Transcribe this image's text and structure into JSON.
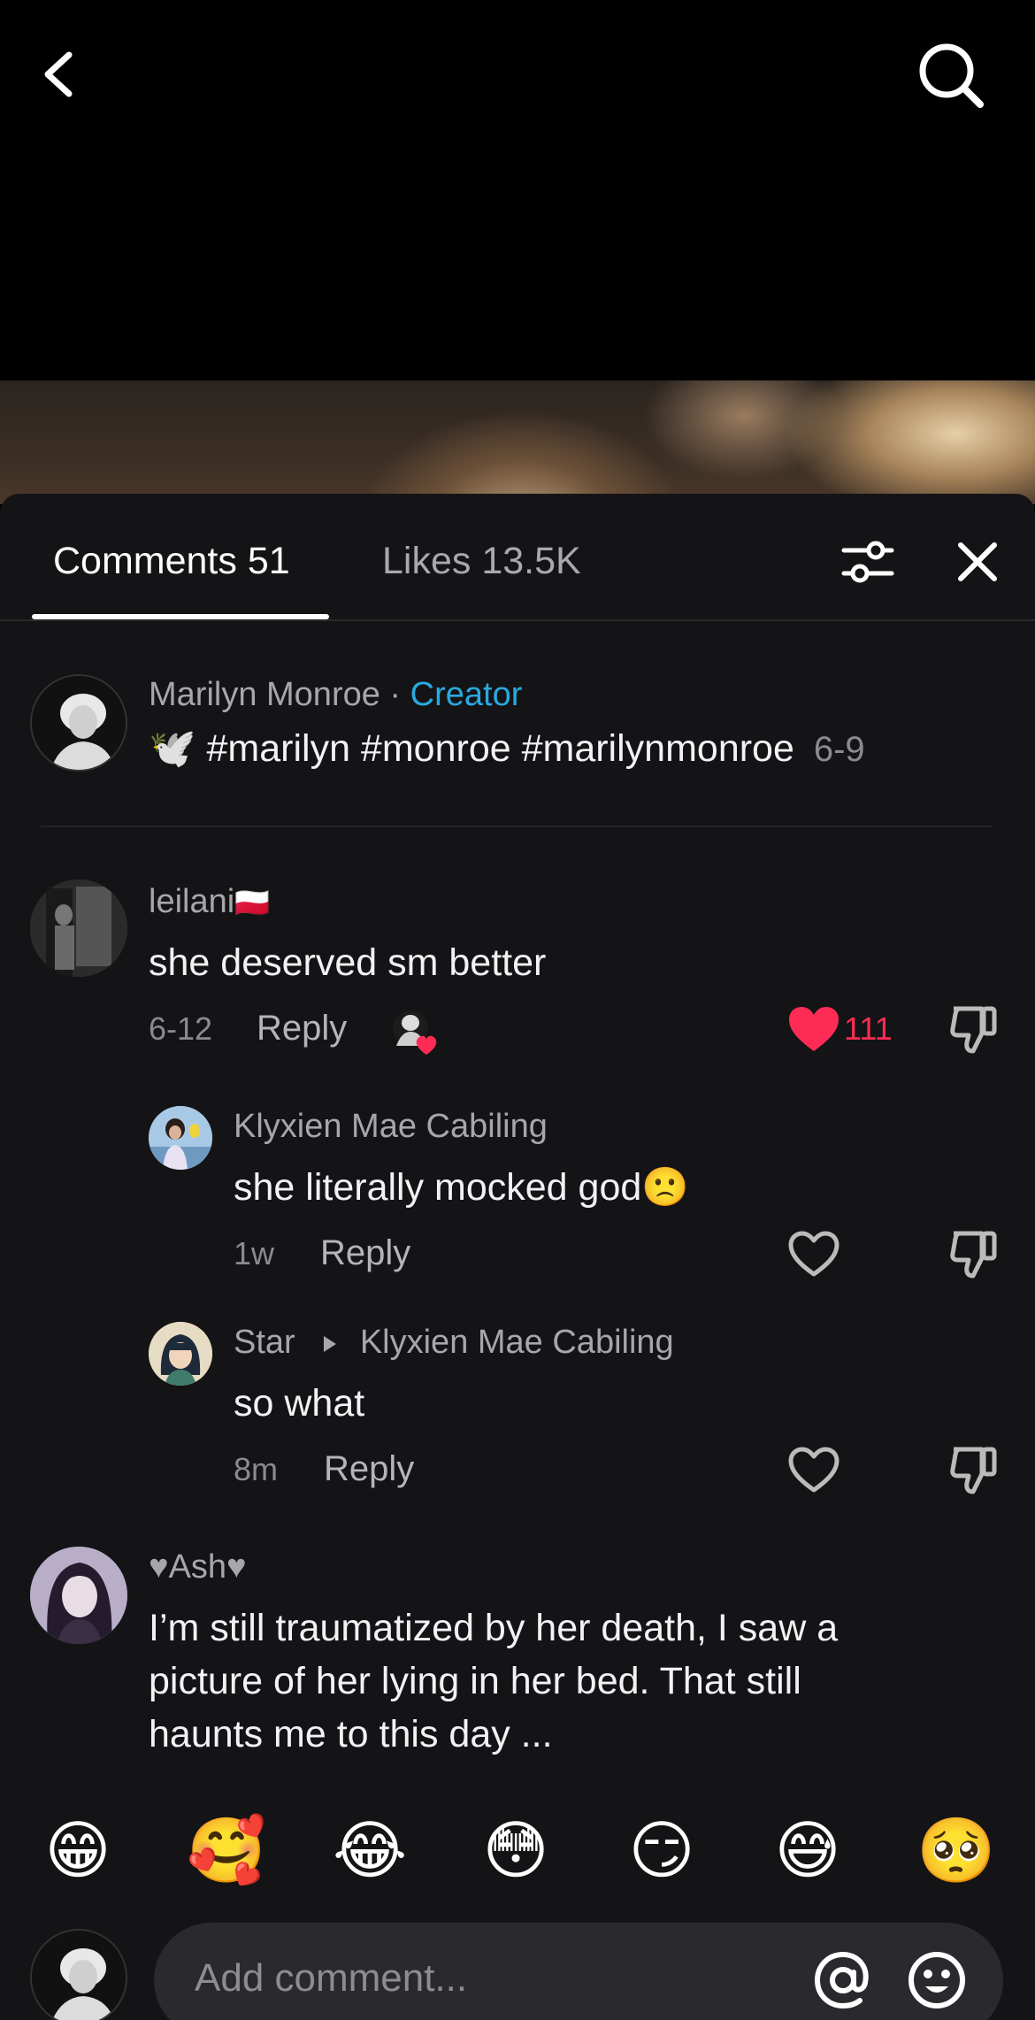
{
  "tabs": {
    "comments": "Comments 51",
    "likes": "Likes 13.5K"
  },
  "caption": {
    "author": "Marilyn Monroe",
    "separator": " · ",
    "badge": "Creator",
    "dove": "🕊️",
    "text": "#marilyn #monroe #marilynmonroe",
    "date": "6-9"
  },
  "comments": [
    {
      "username": "leilani",
      "flag": "🇵🇱",
      "text": "she deserved sm better",
      "time": "6-12",
      "reply": "Reply",
      "likes": "111",
      "liked": true
    },
    {
      "username": "Klyxien Mae Cabiling",
      "text": "she literally mocked god🙁",
      "time": "1w",
      "reply": "Reply"
    },
    {
      "username": "Star",
      "reply_to": "Klyxien Mae Cabiling",
      "text": "so what",
      "time": "8m",
      "reply": "Reply"
    },
    {
      "username": "♥Ash♥",
      "lines": [
        "I’m still traumatized by her death, I saw a",
        "picture of her lying in her bed. That still",
        "haunts me to this day ..."
      ]
    }
  ],
  "emoji_bar": [
    "😁",
    "🥰",
    "😂",
    "😳",
    "😏",
    "😅",
    "🥺"
  ],
  "composer": {
    "placeholder": "Add comment..."
  },
  "colors": {
    "accent": "#2aa9e0",
    "like": "#fe2c55",
    "sheet": "#141416"
  }
}
